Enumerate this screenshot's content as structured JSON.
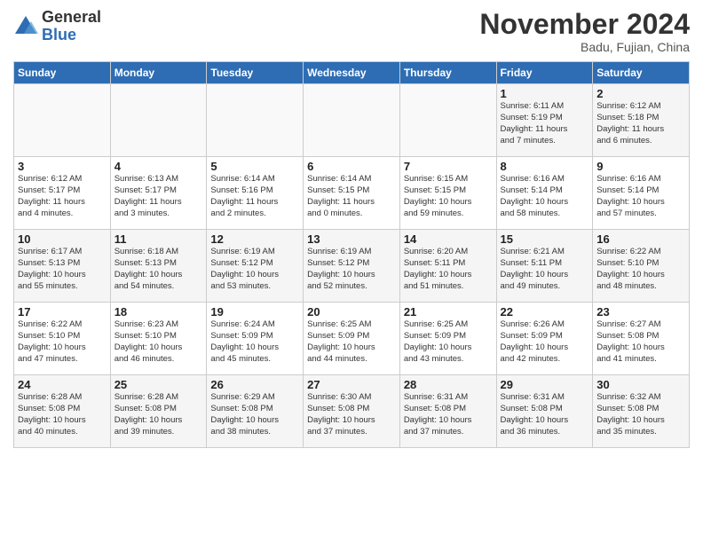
{
  "logo": {
    "general": "General",
    "blue": "Blue"
  },
  "title": "November 2024",
  "location": "Badu, Fujian, China",
  "days_of_week": [
    "Sunday",
    "Monday",
    "Tuesday",
    "Wednesday",
    "Thursday",
    "Friday",
    "Saturday"
  ],
  "weeks": [
    [
      {
        "day": "",
        "info": ""
      },
      {
        "day": "",
        "info": ""
      },
      {
        "day": "",
        "info": ""
      },
      {
        "day": "",
        "info": ""
      },
      {
        "day": "",
        "info": ""
      },
      {
        "day": "1",
        "info": "Sunrise: 6:11 AM\nSunset: 5:19 PM\nDaylight: 11 hours\nand 7 minutes."
      },
      {
        "day": "2",
        "info": "Sunrise: 6:12 AM\nSunset: 5:18 PM\nDaylight: 11 hours\nand 6 minutes."
      }
    ],
    [
      {
        "day": "3",
        "info": "Sunrise: 6:12 AM\nSunset: 5:17 PM\nDaylight: 11 hours\nand 4 minutes."
      },
      {
        "day": "4",
        "info": "Sunrise: 6:13 AM\nSunset: 5:17 PM\nDaylight: 11 hours\nand 3 minutes."
      },
      {
        "day": "5",
        "info": "Sunrise: 6:14 AM\nSunset: 5:16 PM\nDaylight: 11 hours\nand 2 minutes."
      },
      {
        "day": "6",
        "info": "Sunrise: 6:14 AM\nSunset: 5:15 PM\nDaylight: 11 hours\nand 0 minutes."
      },
      {
        "day": "7",
        "info": "Sunrise: 6:15 AM\nSunset: 5:15 PM\nDaylight: 10 hours\nand 59 minutes."
      },
      {
        "day": "8",
        "info": "Sunrise: 6:16 AM\nSunset: 5:14 PM\nDaylight: 10 hours\nand 58 minutes."
      },
      {
        "day": "9",
        "info": "Sunrise: 6:16 AM\nSunset: 5:14 PM\nDaylight: 10 hours\nand 57 minutes."
      }
    ],
    [
      {
        "day": "10",
        "info": "Sunrise: 6:17 AM\nSunset: 5:13 PM\nDaylight: 10 hours\nand 55 minutes."
      },
      {
        "day": "11",
        "info": "Sunrise: 6:18 AM\nSunset: 5:13 PM\nDaylight: 10 hours\nand 54 minutes."
      },
      {
        "day": "12",
        "info": "Sunrise: 6:19 AM\nSunset: 5:12 PM\nDaylight: 10 hours\nand 53 minutes."
      },
      {
        "day": "13",
        "info": "Sunrise: 6:19 AM\nSunset: 5:12 PM\nDaylight: 10 hours\nand 52 minutes."
      },
      {
        "day": "14",
        "info": "Sunrise: 6:20 AM\nSunset: 5:11 PM\nDaylight: 10 hours\nand 51 minutes."
      },
      {
        "day": "15",
        "info": "Sunrise: 6:21 AM\nSunset: 5:11 PM\nDaylight: 10 hours\nand 49 minutes."
      },
      {
        "day": "16",
        "info": "Sunrise: 6:22 AM\nSunset: 5:10 PM\nDaylight: 10 hours\nand 48 minutes."
      }
    ],
    [
      {
        "day": "17",
        "info": "Sunrise: 6:22 AM\nSunset: 5:10 PM\nDaylight: 10 hours\nand 47 minutes."
      },
      {
        "day": "18",
        "info": "Sunrise: 6:23 AM\nSunset: 5:10 PM\nDaylight: 10 hours\nand 46 minutes."
      },
      {
        "day": "19",
        "info": "Sunrise: 6:24 AM\nSunset: 5:09 PM\nDaylight: 10 hours\nand 45 minutes."
      },
      {
        "day": "20",
        "info": "Sunrise: 6:25 AM\nSunset: 5:09 PM\nDaylight: 10 hours\nand 44 minutes."
      },
      {
        "day": "21",
        "info": "Sunrise: 6:25 AM\nSunset: 5:09 PM\nDaylight: 10 hours\nand 43 minutes."
      },
      {
        "day": "22",
        "info": "Sunrise: 6:26 AM\nSunset: 5:09 PM\nDaylight: 10 hours\nand 42 minutes."
      },
      {
        "day": "23",
        "info": "Sunrise: 6:27 AM\nSunset: 5:08 PM\nDaylight: 10 hours\nand 41 minutes."
      }
    ],
    [
      {
        "day": "24",
        "info": "Sunrise: 6:28 AM\nSunset: 5:08 PM\nDaylight: 10 hours\nand 40 minutes."
      },
      {
        "day": "25",
        "info": "Sunrise: 6:28 AM\nSunset: 5:08 PM\nDaylight: 10 hours\nand 39 minutes."
      },
      {
        "day": "26",
        "info": "Sunrise: 6:29 AM\nSunset: 5:08 PM\nDaylight: 10 hours\nand 38 minutes."
      },
      {
        "day": "27",
        "info": "Sunrise: 6:30 AM\nSunset: 5:08 PM\nDaylight: 10 hours\nand 37 minutes."
      },
      {
        "day": "28",
        "info": "Sunrise: 6:31 AM\nSunset: 5:08 PM\nDaylight: 10 hours\nand 37 minutes."
      },
      {
        "day": "29",
        "info": "Sunrise: 6:31 AM\nSunset: 5:08 PM\nDaylight: 10 hours\nand 36 minutes."
      },
      {
        "day": "30",
        "info": "Sunrise: 6:32 AM\nSunset: 5:08 PM\nDaylight: 10 hours\nand 35 minutes."
      }
    ]
  ]
}
